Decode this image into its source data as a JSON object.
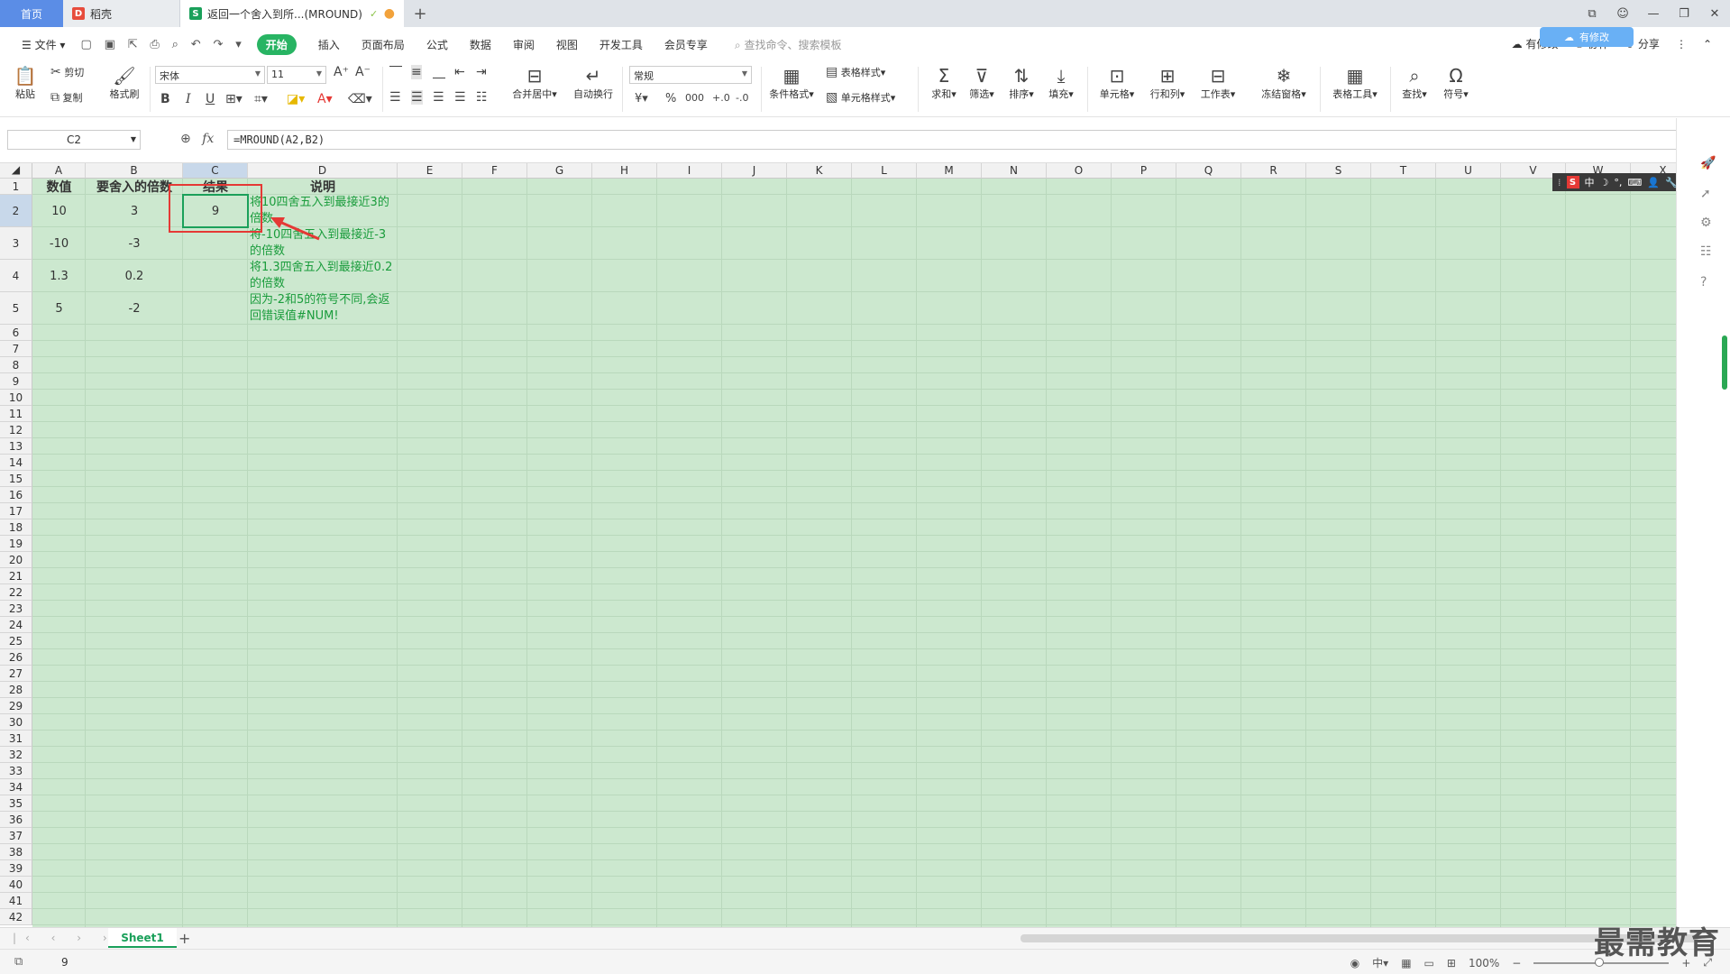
{
  "tabs": {
    "home": "首页",
    "shell": "稻壳",
    "doc": "返回一个舍入到所...(MROUND)",
    "add": "+"
  },
  "menu": {
    "file": "文件",
    "start": "开始",
    "insert": "插入",
    "page_layout": "页面布局",
    "formulas": "公式",
    "data": "数据",
    "review": "审阅",
    "view": "视图",
    "dev_tools": "开发工具",
    "member": "会员专享",
    "search_placeholder": "查找命令、搜索模板",
    "unsynced": "有修改",
    "cooperate": "协作",
    "share": "分享",
    "cloud_badge": "有修改"
  },
  "ribbon": {
    "paste": "粘贴",
    "cut": "剪切",
    "copy": "复制",
    "format_painter": "格式刷",
    "font_name": "宋体",
    "font_size": "11",
    "bold": "B",
    "italic": "I",
    "underline": "U",
    "merge_center": "合并居中",
    "auto_wrap": "自动换行",
    "number_format": "常规",
    "conditional_format": "条件格式",
    "table_style": "表格样式",
    "cell_style": "单元格样式",
    "sum": "求和",
    "filter": "筛选",
    "sort": "排序",
    "fill": "填充",
    "cell": "单元格",
    "row_col": "行和列",
    "worksheet": "工作表",
    "freeze": "冻结窗格",
    "table_tools": "表格工具",
    "find": "查找",
    "symbol": "符号",
    "currency": "¥",
    "percent": "%",
    "thousands": "000"
  },
  "formula_bar": {
    "name_box": "C2",
    "fx": "fx",
    "formula": "=MROUND(A2,B2)"
  },
  "columns": [
    "A",
    "B",
    "C",
    "D",
    "E",
    "F",
    "G",
    "H",
    "I",
    "J",
    "K",
    "L",
    "M",
    "N",
    "O",
    "P",
    "Q",
    "R",
    "S",
    "T",
    "U",
    "V",
    "W",
    "X"
  ],
  "rows": [
    "1",
    "2",
    "3",
    "4",
    "5",
    "6",
    "7",
    "8",
    "9",
    "10",
    "11",
    "12",
    "13",
    "14",
    "15",
    "16",
    "17",
    "18",
    "19",
    "20",
    "21",
    "22",
    "23",
    "24",
    "25",
    "26",
    "27",
    "28",
    "29",
    "30",
    "31",
    "32",
    "33",
    "34",
    "35",
    "36",
    "37",
    "38",
    "39",
    "40",
    "41",
    "42"
  ],
  "sheet": {
    "headers": [
      "数值",
      "要舍入的倍数",
      "结果",
      "说明"
    ],
    "data": [
      {
        "a": "10",
        "b": "3",
        "c": "9",
        "d": "将10四舍五入到最接近3的倍数"
      },
      {
        "a": "-10",
        "b": "-3",
        "c": "",
        "d": "将-10四舍五入到最接近-3的倍数"
      },
      {
        "a": "1.3",
        "b": "0.2",
        "c": "",
        "d": "将1.3四舍五入到最接近0.2的倍数"
      },
      {
        "a": "5",
        "b": "-2",
        "c": "",
        "d": "因为-2和5的符号不同,会返回错误值#NUM!"
      }
    ]
  },
  "ime": {
    "lang": "中",
    "s": "S"
  },
  "sheet_tabs": {
    "sheet1": "Sheet1",
    "add": "+"
  },
  "status": {
    "value": "9",
    "zoom": "100%"
  },
  "watermark": "最需教育",
  "colors": {
    "accent": "#1aa05a",
    "sheet_bg": "#cce8cf",
    "red": "#e53935"
  }
}
